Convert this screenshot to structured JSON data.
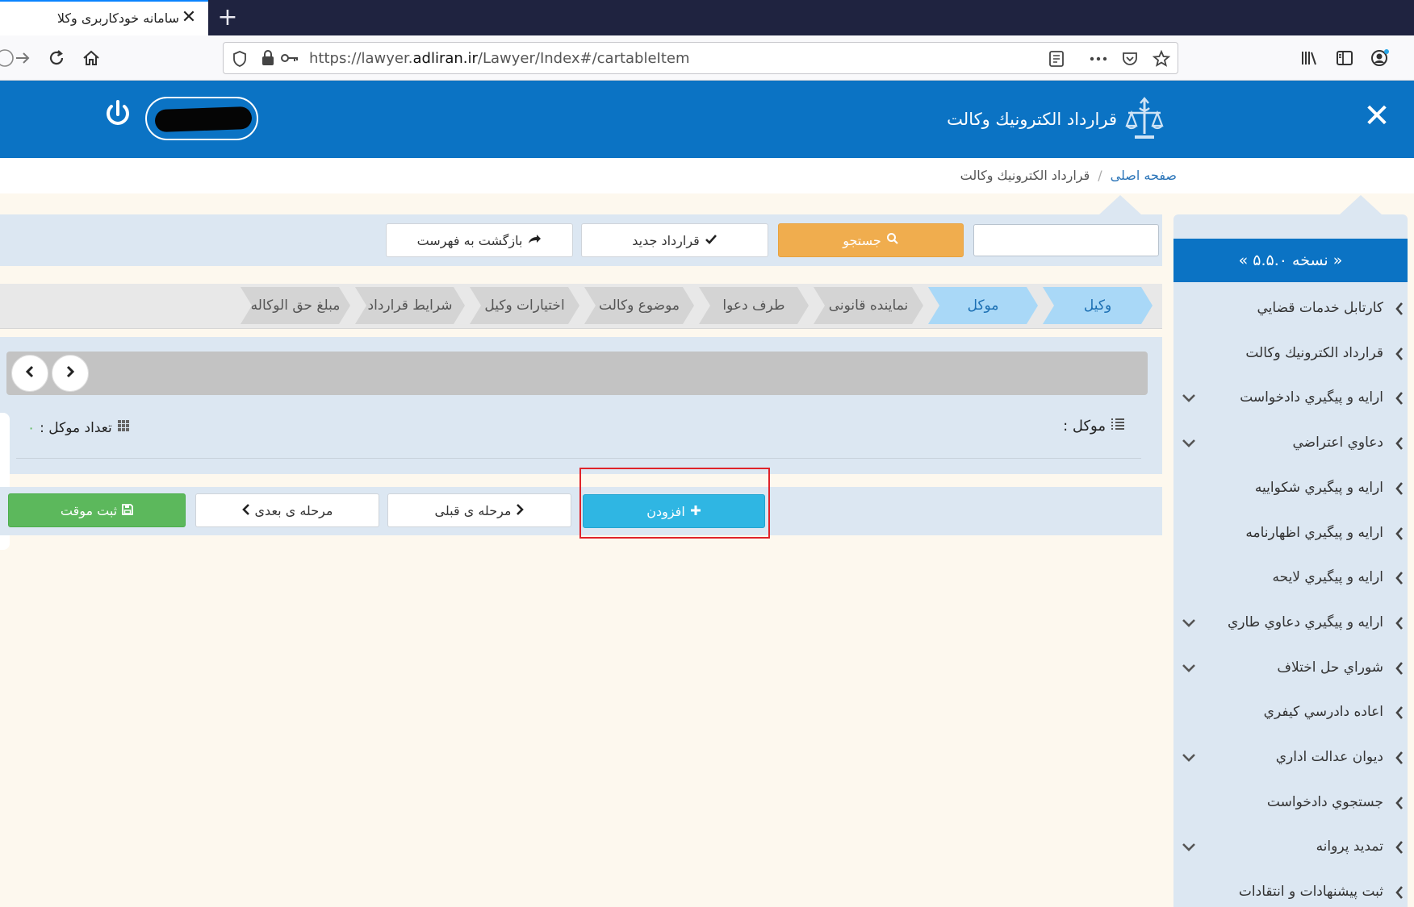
{
  "browser": {
    "tab_title": "سامانه خودکاربری وکلا",
    "url_prefix": "https://lawyer.",
    "url_domain": "adliran.ir",
    "url_path": "/Lawyer/Index#/cartableItem"
  },
  "header": {
    "title": "قرارداد الكترونيك وكالت"
  },
  "breadcrumb": {
    "home": "صفحه اصلی",
    "separator": "/",
    "current": "قرارداد الكترونيك وكالت"
  },
  "sidebar": {
    "version": "« نسخه ۵.۵.۰ »",
    "items": [
      {
        "label": "كارتابل خدمات قضايي",
        "expandable": false
      },
      {
        "label": "قرارداد الكترونيك وكالت",
        "expandable": false
      },
      {
        "label": "ارايه و پيگيري دادخواست",
        "expandable": true
      },
      {
        "label": "دعاوي اعتراضي",
        "expandable": true
      },
      {
        "label": "ارايه و پيگيري شكواييه",
        "expandable": false
      },
      {
        "label": "ارايه و پيگيري اظهارنامه",
        "expandable": false
      },
      {
        "label": "ارايه و پيگيري لايحه",
        "expandable": false
      },
      {
        "label": "ارايه و پيگيري دعاوي طاري",
        "expandable": true
      },
      {
        "label": "شوراي حل اختلاف",
        "expandable": true
      },
      {
        "label": "اعاده دادرسي كيفري",
        "expandable": false
      },
      {
        "label": "ديوان عدالت اداري",
        "expandable": true
      },
      {
        "label": "جستجوي دادخواست",
        "expandable": false
      },
      {
        "label": "تمديد پروانه",
        "expandable": true
      },
      {
        "label": "ثبت پيشنهادات و انتقادات",
        "expandable": false
      }
    ]
  },
  "toolbar": {
    "search_placeholder": "",
    "search_label": "جستجو",
    "new_contract_label": "قرارداد جدید",
    "back_label": "بازگشت به فهرست"
  },
  "steps": [
    {
      "label": "وكيل",
      "active": true
    },
    {
      "label": "موكل",
      "active": true
    },
    {
      "label": "نماينده قانونى",
      "active": false
    },
    {
      "label": "طرف دعوا",
      "active": false
    },
    {
      "label": "موضوع وكالت",
      "active": false
    },
    {
      "label": "اختيارات وكيل",
      "active": false
    },
    {
      "label": "شرايط قرارداد",
      "active": false
    },
    {
      "label": "مبلغ حق الوكاله",
      "active": false
    }
  ],
  "panel": {
    "client_label": "موكل :",
    "count_label": "تعداد موكل :",
    "count_value": "۰"
  },
  "actions": {
    "add_label": "افزودن",
    "prev_label": "مرحله ی قبلی",
    "next_label": "مرحله ی بعدی",
    "save_temp_label": "ثبت موقت"
  },
  "colors": {
    "brand_blue": "#0b73c4",
    "search_orange": "#f0ad4e",
    "add_cyan": "#2fb6e3",
    "save_green": "#5cb85c",
    "highlight_red": "#e0232a"
  }
}
